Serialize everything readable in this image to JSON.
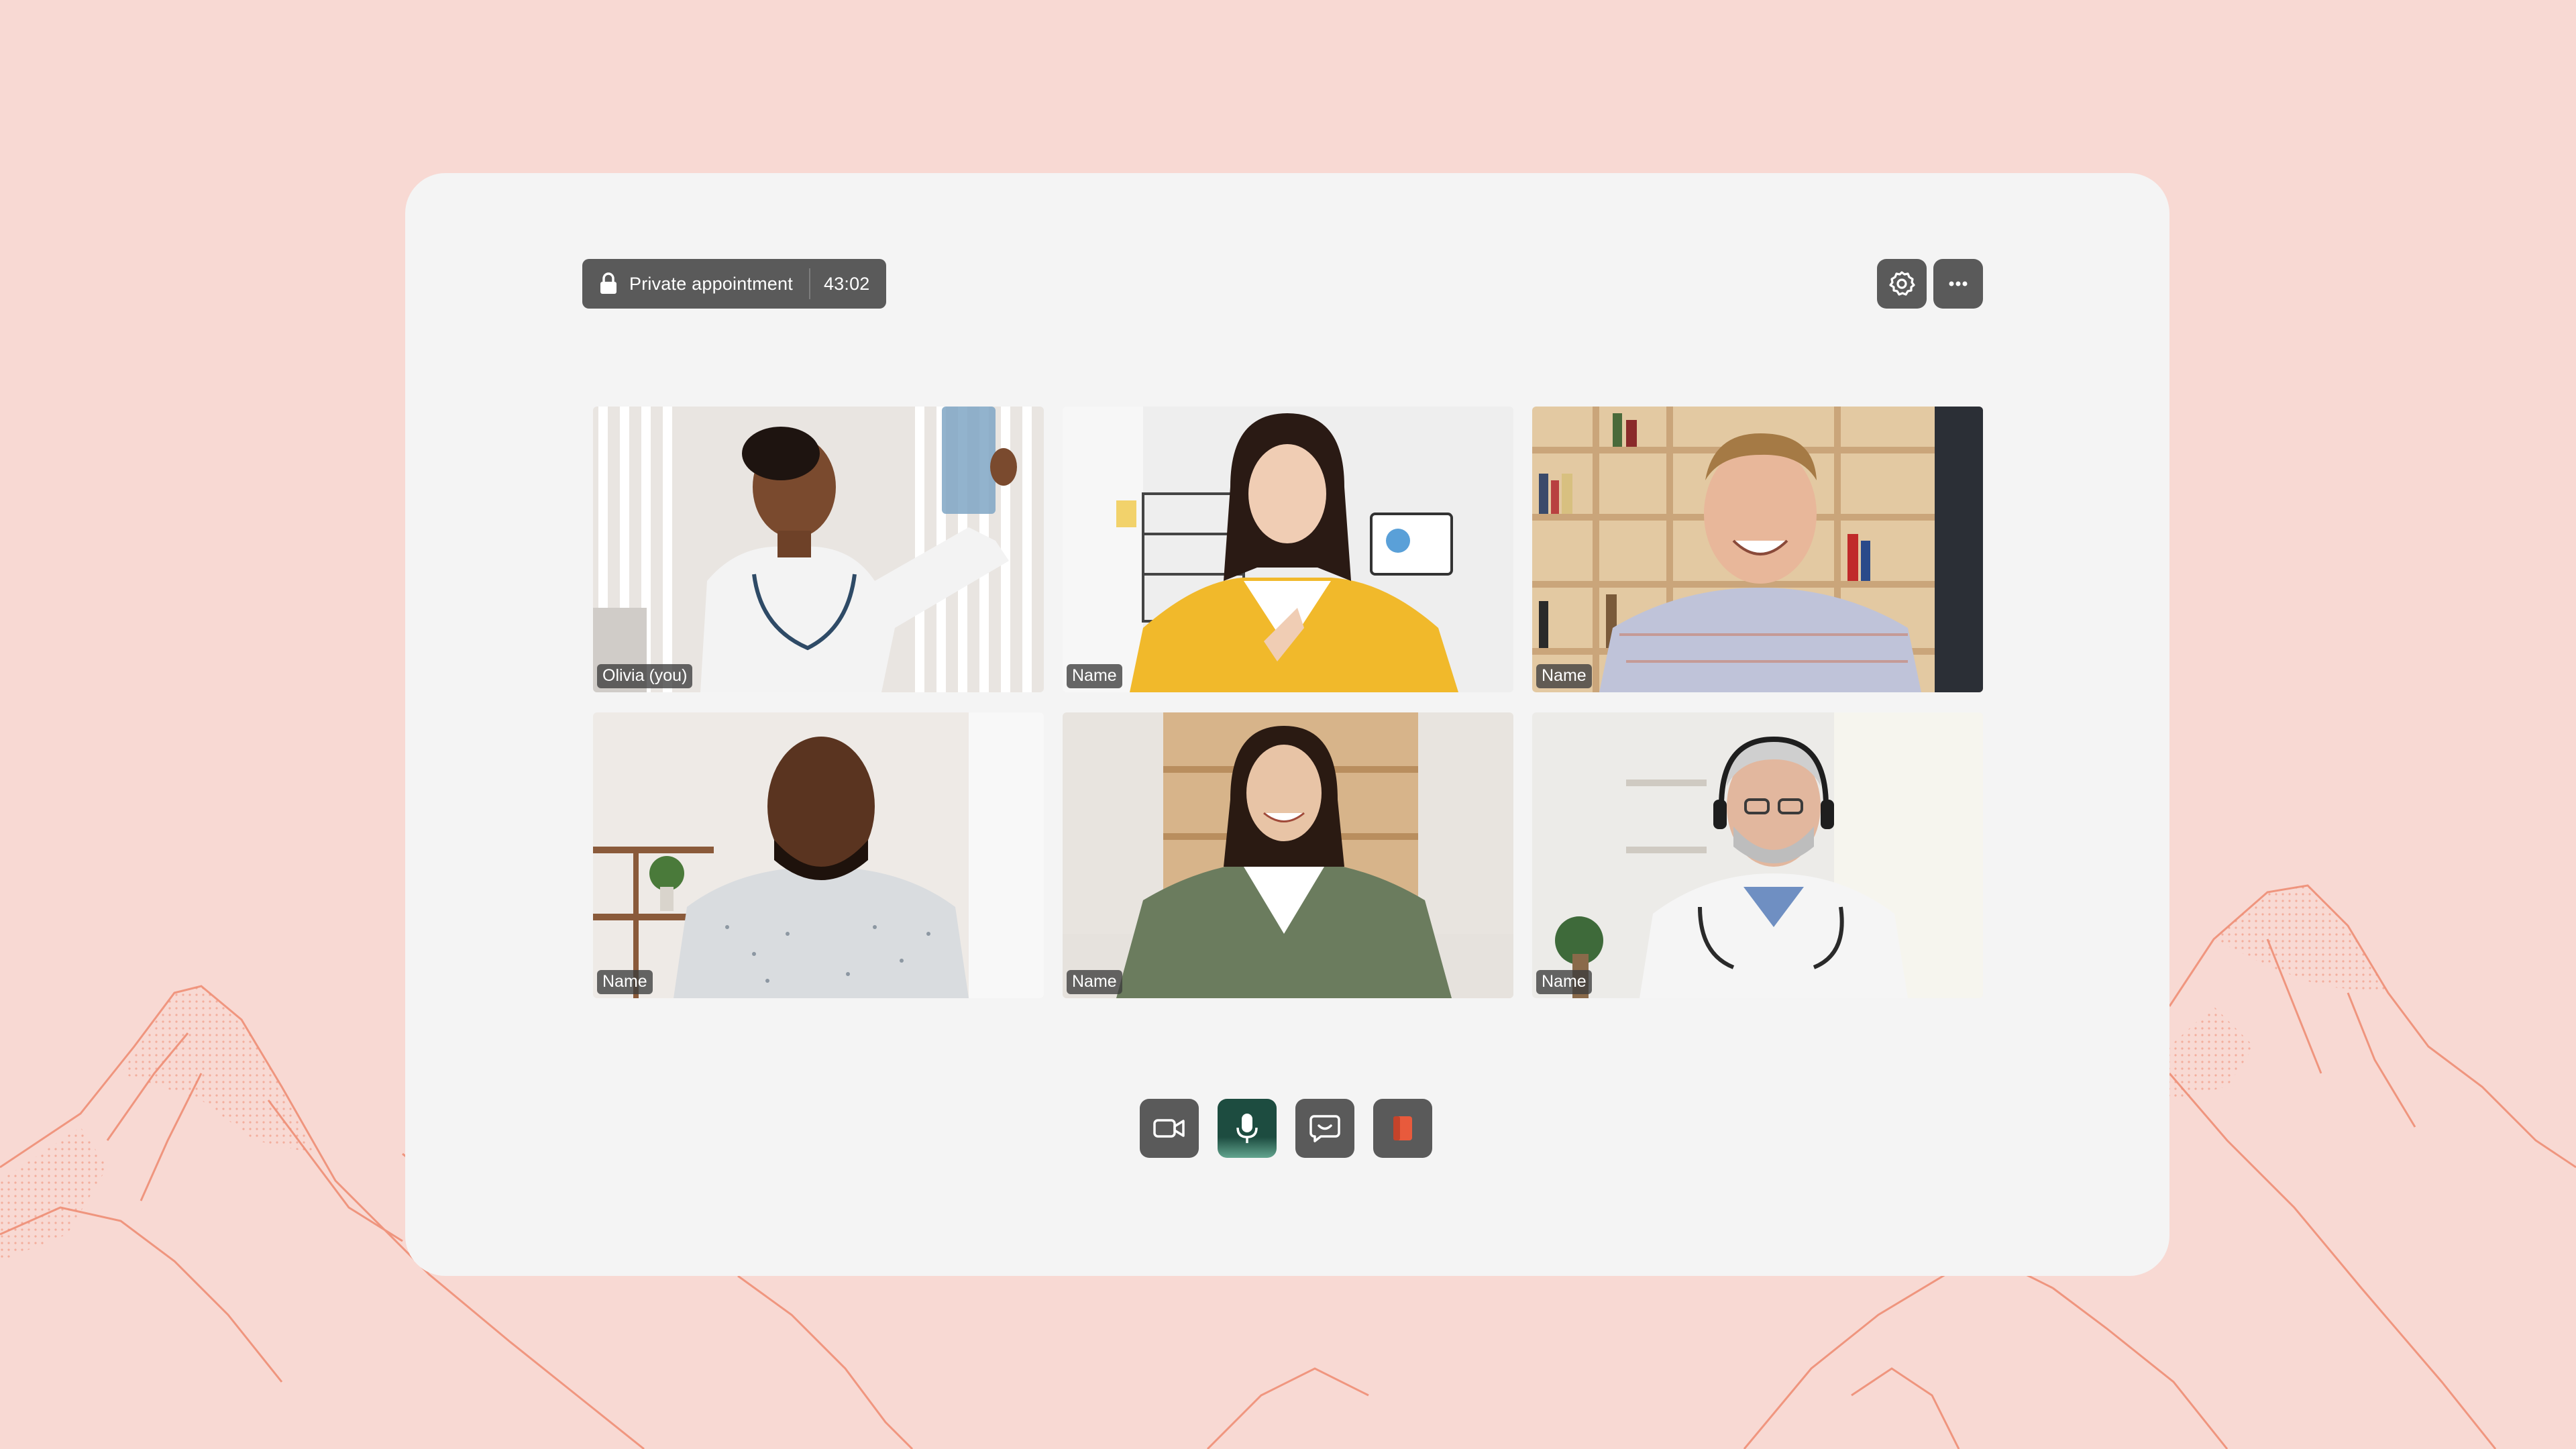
{
  "meeting": {
    "title": "Private appointment",
    "timer": "43:02"
  },
  "header_icons": {
    "settings": "gear-icon",
    "more": "more-horizontal-icon"
  },
  "participants": [
    {
      "name": "Olivia (you)",
      "scene": "doctor-with-xray"
    },
    {
      "name": "Name",
      "scene": "woman-yellow-jacket"
    },
    {
      "name": "Name",
      "scene": "man-bookshelf"
    },
    {
      "name": "Name",
      "scene": "man-patterned-shirt"
    },
    {
      "name": "Name",
      "scene": "woman-green-cardigan"
    },
    {
      "name": "Name",
      "scene": "senior-doctor-headset"
    }
  ],
  "controls": [
    {
      "name": "camera",
      "icon": "video-camera-icon"
    },
    {
      "name": "microphone",
      "icon": "microphone-icon",
      "active": true
    },
    {
      "name": "chat",
      "icon": "chat-icon"
    },
    {
      "name": "leave",
      "icon": "leave-door-icon"
    }
  ],
  "colors": {
    "background": "#f8d9d3",
    "window": "#f4f4f4",
    "button": "#5a5a5a",
    "mic_active": "#1d4c40",
    "leave_accent": "#e85a3c",
    "mountain_line": "#ee8a70"
  }
}
